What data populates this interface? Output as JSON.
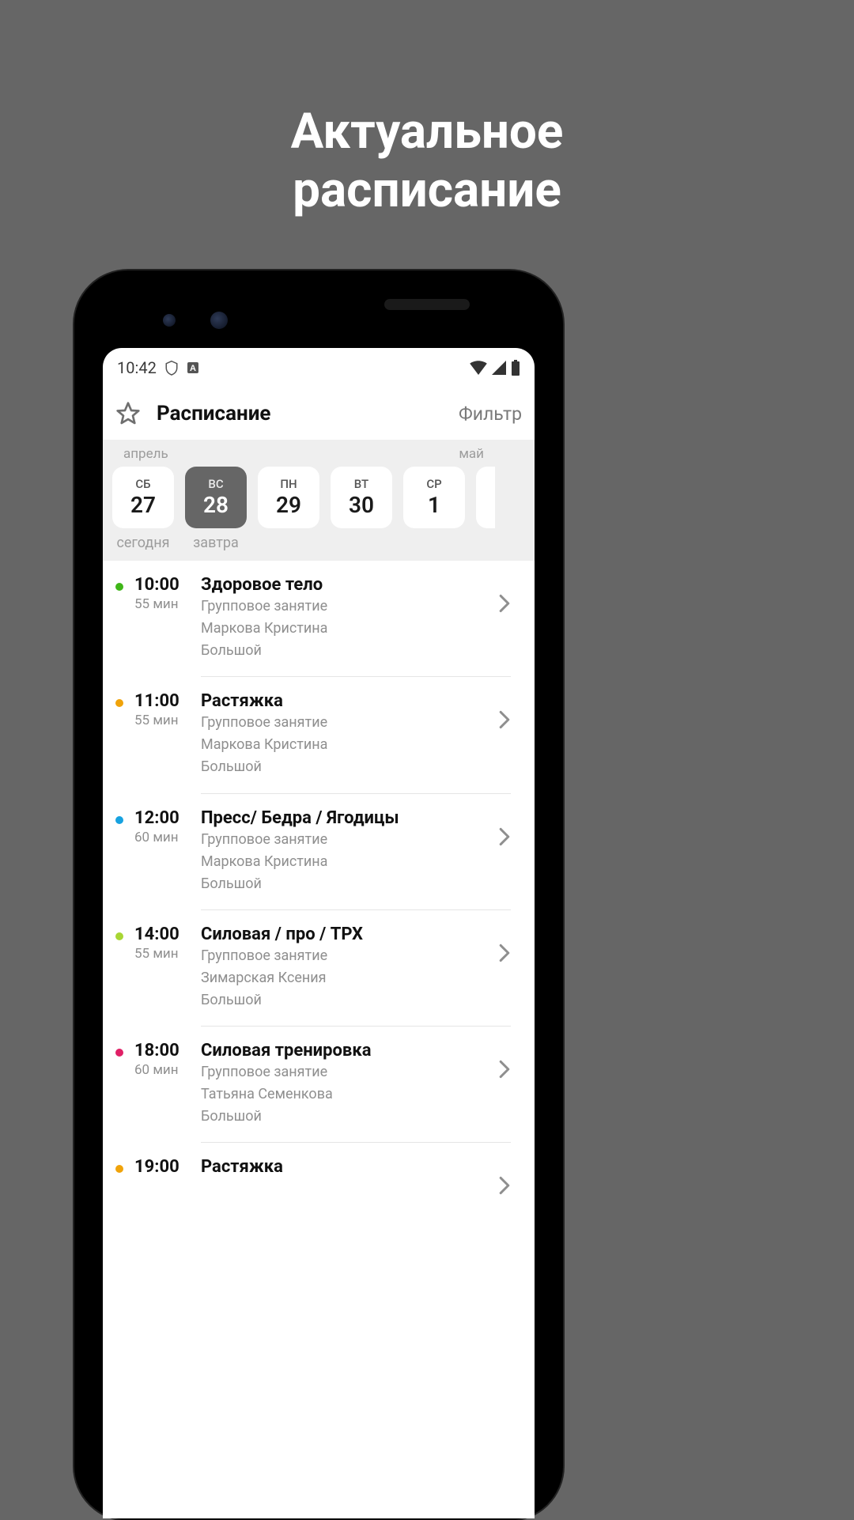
{
  "promo": {
    "line1": "Актуальное",
    "line2": "расписание"
  },
  "statusbar": {
    "time": "10:42"
  },
  "header": {
    "title": "Расписание",
    "filter": "Фильтр"
  },
  "datestrip": {
    "month_left": "апрель",
    "month_right": "май",
    "today_label": "сегодня",
    "tomorrow_label": "завтра",
    "days": [
      {
        "dow": "СБ",
        "num": "27",
        "selected": false
      },
      {
        "dow": "ВС",
        "num": "28",
        "selected": true
      },
      {
        "dow": "ПН",
        "num": "29",
        "selected": false
      },
      {
        "dow": "ВТ",
        "num": "30",
        "selected": false
      },
      {
        "dow": "СР",
        "num": "1",
        "selected": false
      }
    ]
  },
  "classes": [
    {
      "time": "10:00",
      "duration": "55 мин",
      "name": "Здоровое тело",
      "type": "Групповое занятие",
      "trainer": "Маркова Кристина",
      "room": "Большой",
      "dot": "#3fb618"
    },
    {
      "time": "11:00",
      "duration": "55 мин",
      "name": "Растяжка",
      "type": "Групповое занятие",
      "trainer": "Маркова Кристина",
      "room": "Большой",
      "dot": "#f0a30a"
    },
    {
      "time": "12:00",
      "duration": "60 мин",
      "name": "Пресс/ Бедра / Ягодицы",
      "type": "Групповое занятие",
      "trainer": "Маркова Кристина",
      "room": "Большой",
      "dot": "#17a2e0"
    },
    {
      "time": "14:00",
      "duration": "55 мин",
      "name": "Силовая / про / TPX",
      "type": "Групповое занятие",
      "trainer": "Зимарская Ксения",
      "room": "Большой",
      "dot": "#a8d634"
    },
    {
      "time": "18:00",
      "duration": "60 мин",
      "name": "Силовая тренировка",
      "type": "Групповое занятие",
      "trainer": "Татьяна Семенкова",
      "room": "Большой",
      "dot": "#e02066"
    },
    {
      "time": "19:00",
      "duration": "",
      "name": "Растяжка",
      "type": "",
      "trainer": "",
      "room": "",
      "dot": "#f0a30a"
    }
  ]
}
